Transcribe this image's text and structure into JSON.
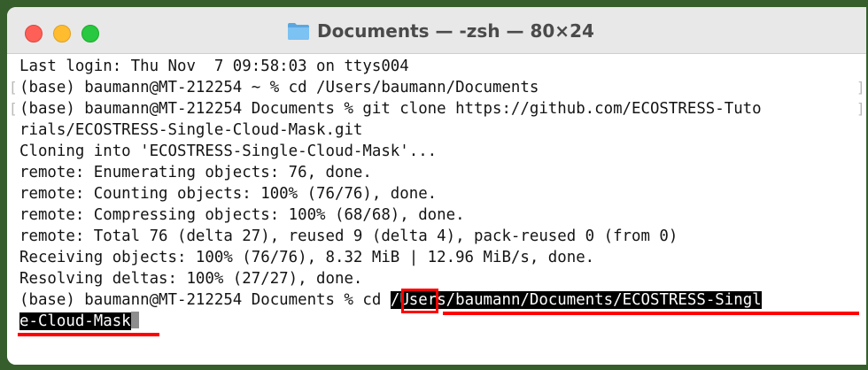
{
  "window": {
    "title": "Documents — -zsh — 80×24",
    "folder_icon": "folder-icon",
    "traffic_lights": {
      "close": "#fe5f57",
      "minimize": "#febc2e",
      "zoom": "#28c840"
    }
  },
  "terminal": {
    "lines": [
      "Last login: Thu Nov  7 09:58:03 on ttys004",
      "(base) baumann@MT-212254 ~ % cd /Users/baumann/Documents",
      "(base) baumann@MT-212254 Documents % git clone https://github.com/ECOSTRESS-Tuto",
      "rials/ECOSTRESS-Single-Cloud-Mask.git",
      "Cloning into 'ECOSTRESS-Single-Cloud-Mask'...",
      "remote: Enumerating objects: 76, done.",
      "remote: Counting objects: 100% (76/76), done.",
      "remote: Compressing objects: 100% (68/68), done.",
      "remote: Total 76 (delta 27), reused 9 (delta 4), pack-reused 0 (from 0)",
      "Receiving objects: 100% (76/76), 8.32 MiB | 12.96 MiB/s, done.",
      "Resolving deltas: 100% (27/27), done."
    ],
    "prompt": "(base) baumann@MT-212254 Documents % ",
    "cmd": "cd",
    "path_part1": "/Users/baumann/Documents/ECOSTRESS-Singl",
    "path_part2": "e-Cloud-Mask"
  },
  "colors": {
    "annotation": "#ff0000",
    "background": "#355e2c"
  }
}
